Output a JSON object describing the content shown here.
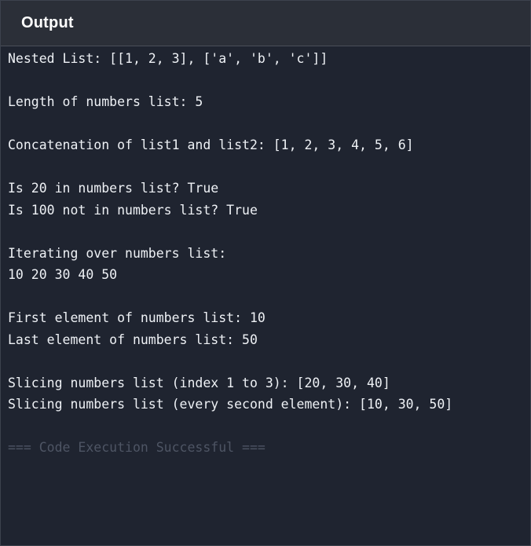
{
  "header": {
    "title": "Output"
  },
  "output": {
    "lines": [
      "Nested List: [[1, 2, 3], ['a', 'b', 'c']]",
      "",
      "Length of numbers list: 5",
      "",
      "Concatenation of list1 and list2: [1, 2, 3, 4, 5, 6]",
      "",
      "Is 20 in numbers list? True",
      "Is 100 not in numbers list? True",
      "",
      "Iterating over numbers list:",
      "10 20 30 40 50",
      "",
      "First element of numbers list: 10",
      "Last element of numbers list: 50",
      "",
      "Slicing numbers list (index 1 to 3): [20, 30, 40]",
      "Slicing numbers list (every second element): [10, 30, 50]",
      "",
      "=== Code Execution Successful ==="
    ]
  },
  "colors": {
    "background": "#1f2430",
    "header_background": "#2b2f38",
    "text": "#eef1f5",
    "status_text": "#4e5564"
  }
}
